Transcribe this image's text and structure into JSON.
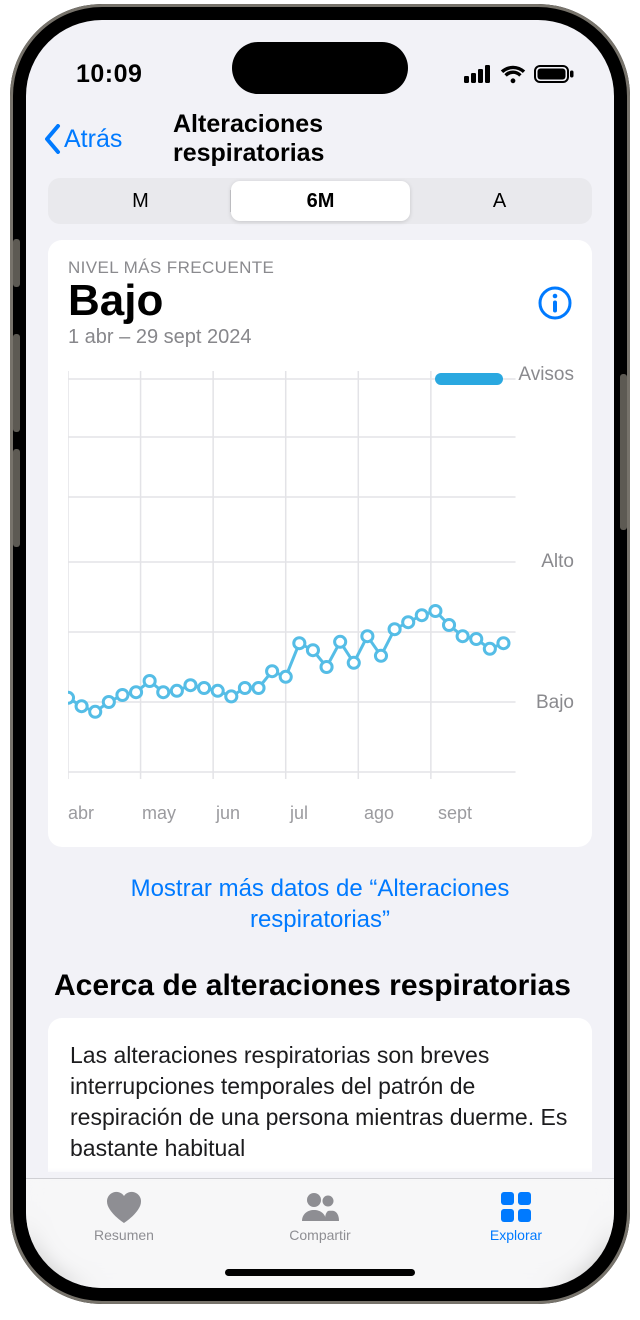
{
  "status": {
    "time": "10:09"
  },
  "nav": {
    "back": "Atrás",
    "title": "Alteraciones respiratorias"
  },
  "segments": {
    "m": "M",
    "m6": "6M",
    "a": "A"
  },
  "summary": {
    "label": "NIVEL MÁS FRECUENTE",
    "value": "Bajo",
    "range": "1 abr – 29 sept 2024"
  },
  "axis": {
    "avisos": "Avisos",
    "alto": "Alto",
    "bajo": "Bajo"
  },
  "xticks": {
    "abr": "abr",
    "may": "may",
    "jun": "jun",
    "jul": "jul",
    "ago": "ago",
    "sept": "sept"
  },
  "more_link": "Mostrar más datos de “Alteraciones respiratorias”",
  "about": {
    "title": "Acerca de alteraciones respiratorias",
    "body": "Las alteraciones respiratorias son breves interrupciones temporales del patrón de respiración de una persona mientras duerme. Es bastante habitual"
  },
  "tabs": {
    "resumen": "Resumen",
    "compartir": "Compartir",
    "explorar": "Explorar"
  },
  "chart_data": {
    "type": "line",
    "title": "Alteraciones respiratorias — 6M",
    "ylabel": "Nivel",
    "y_categories_top_to_bottom": [
      "Avisos",
      "Alto",
      "Bajo"
    ],
    "x_tick_labels": [
      "abr",
      "may",
      "jun",
      "jul",
      "ago",
      "sept"
    ],
    "x": [
      0,
      1,
      2,
      3,
      4,
      5,
      6,
      7,
      8,
      9,
      10,
      11,
      12,
      13,
      14,
      15,
      16,
      17,
      18,
      19,
      20,
      21,
      22,
      23,
      24,
      25,
      26,
      27,
      28,
      29,
      30,
      31,
      32
    ],
    "values_scale_note": "0 = línea Bajo (valor base); 1 = línea Alto; valores intermedios estimados visualmente",
    "values": [
      0.03,
      -0.03,
      -0.07,
      0.0,
      0.05,
      0.07,
      0.15,
      0.07,
      0.08,
      0.12,
      0.1,
      0.08,
      0.04,
      0.1,
      0.1,
      0.22,
      0.18,
      0.42,
      0.37,
      0.25,
      0.43,
      0.28,
      0.47,
      0.33,
      0.52,
      0.57,
      0.62,
      0.65,
      0.55,
      0.47,
      0.45,
      0.38,
      0.42
    ],
    "alerts_segment": {
      "from_index": 27,
      "to_index": 32,
      "label": "Avisos"
    }
  }
}
